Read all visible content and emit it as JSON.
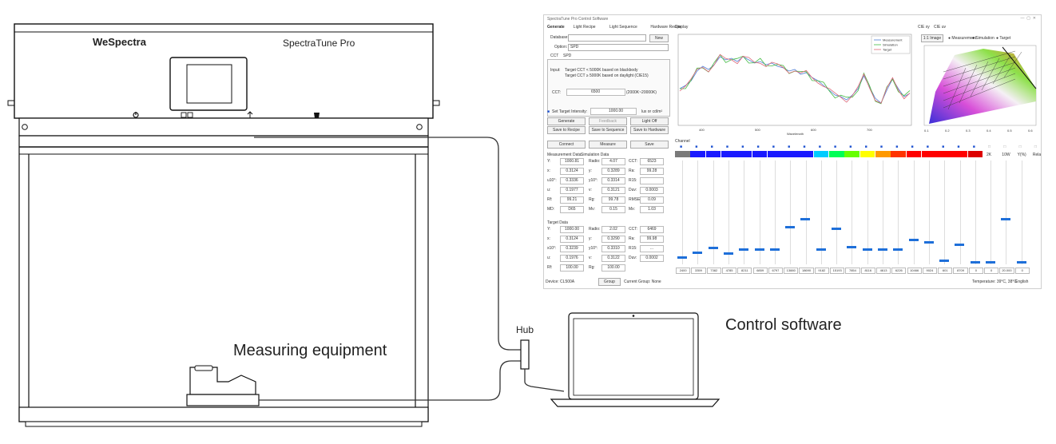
{
  "labels": {
    "brand": "WeSpectra",
    "product": "SpectraTune Pro",
    "measuring": "Measuring equipment",
    "hub": "Hub",
    "control": "Control software"
  },
  "software": {
    "window_title": "SpectraTune Pro Control Software",
    "tabs": [
      "Generate",
      "Light Recipe",
      "Light Sequence",
      "Hardware Recipe"
    ],
    "database_label": "Database:",
    "new_button": "New",
    "option_label": "Option:",
    "option_value": "SPD",
    "subtabs": [
      "CCT",
      "SPD"
    ],
    "input_label": "Input:",
    "input_line1": "Target CCT < 5000K based on blackbody",
    "input_line2": "Target CCT ≥ 5000K based on daylight (CIE15)",
    "cct_label": "CCT:",
    "cct_value": "6500",
    "cct_range": "(2000K~20000K)",
    "intensity_label": "Set Target Intensity:",
    "intensity_value": "1000.00",
    "intensity_unit": "lux or cd/m²",
    "buttons": [
      "Generate",
      "Feedback",
      "Light Off",
      "Save to Recipe",
      "Save to Sequence",
      "Save to Hardware",
      "Connect",
      "Measure",
      "Save"
    ],
    "measurement_tabs": [
      "Measurement Data",
      "Simulation Data"
    ],
    "measure_rows": [
      [
        "Y:",
        "1000.81",
        "Radio:",
        "4.07",
        "CCT:",
        "6523"
      ],
      [
        "x:",
        "0.3124",
        "y:",
        "0.3289",
        "Ra:",
        "99.28"
      ],
      [
        "u10°:",
        "0.3336",
        "y10°:",
        "0.3314",
        "R15:",
        ""
      ],
      [
        "u:",
        "0.1977",
        "v:",
        "0.3121",
        "Duv:",
        "0.0003"
      ],
      [
        "Rf:",
        "99.21",
        "Rg:",
        "99.78",
        "RMSE:",
        "0.09"
      ],
      [
        "MD:",
        "D65",
        "Mv:",
        "0.15",
        "Mx:",
        "1.03"
      ]
    ],
    "target_title": "Target Data",
    "target_rows": [
      [
        "Y:",
        "1000.00",
        "Radio:",
        "2.02",
        "CCT:",
        "6469"
      ],
      [
        "x:",
        "0.3124",
        "y:",
        "0.3290",
        "Ra:",
        "99.98"
      ],
      [
        "x10°:",
        "0.3239",
        "y10°:",
        "0.3310",
        "R15:",
        "..."
      ],
      [
        "u:",
        "0.1976",
        "v:",
        "0.3122",
        "Duv:",
        "0.0002"
      ],
      [
        "Rf:",
        "100.00",
        "Rg:",
        "100.00",
        "",
        ""
      ]
    ],
    "display_title": "Display",
    "legend": [
      "Measurement",
      "Simulation",
      "Target"
    ],
    "wavelength_label": "Wavelength",
    "x_ticks": [
      "400",
      "500",
      "600",
      "700"
    ],
    "cie_tabs": [
      "CIE xy",
      "CIE uv"
    ],
    "cie_ratio": "1:1 Image",
    "cie_legend": [
      "Measurement",
      "Simulation",
      "Target"
    ],
    "cie_x_ticks": [
      "0.1",
      "0.2",
      "0.3",
      "0.4",
      "0.5",
      "0.6"
    ],
    "channel_title": "Channel",
    "channel_colors": [
      "#7a7a7a",
      "#1a1aff",
      "#1a1aff",
      "#1a1aff",
      "#1a1aff",
      "#1a1aff",
      "#1a1aff",
      "#1a1aff",
      "#1a1aff",
      "#00ccff",
      "#00ff55",
      "#66ff00",
      "#ffff00",
      "#ff9900",
      "#ff3300",
      "#ff0000",
      "#ff0000",
      "#ff0000",
      "#ff0000",
      "#dd0000",
      "#ffffff",
      "#ffffff",
      "#ffffff",
      "#ffffff"
    ],
    "channel_extra": [
      "2K",
      "10W",
      "Y(%)",
      "Relay"
    ],
    "channel_levels": [
      0.05,
      0.1,
      0.15,
      0.09,
      0.13,
      0.13,
      0.13,
      0.37,
      0.45,
      0.13,
      0.35,
      0.16,
      0.13,
      0.13,
      0.13,
      0.23,
      0.21,
      0.02,
      0.18,
      0.0,
      0.0,
      0.45,
      0.0
    ],
    "channel_values": [
      "2400",
      "3359",
      "7382",
      "4785",
      "8211",
      "6859",
      "6797",
      "13880",
      "18690",
      "9182",
      "15193",
      "7854",
      "8116",
      "4613",
      "6226",
      "10466",
      "9024",
      "601",
      "8709",
      "0",
      "0",
      "20.000",
      "0"
    ],
    "device_label": "Device: CL500A",
    "group_button": "Group",
    "current_group": "Current Group: None",
    "temperature": "Temperature: 39°C, 38°C",
    "language": "English"
  }
}
